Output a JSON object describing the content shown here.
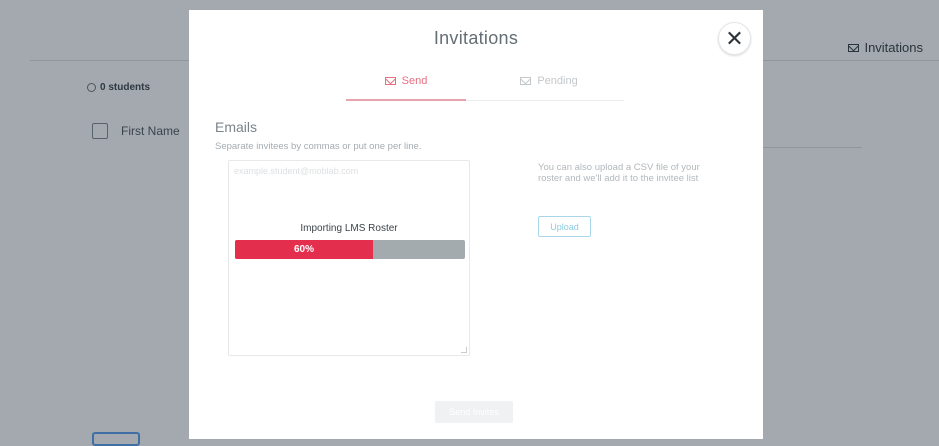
{
  "background": {
    "students_count": "0 students",
    "first_name_header": "First Name",
    "invitations_button": "Invitations"
  },
  "modal": {
    "title": "Invitations",
    "close_icon": "close-icon",
    "tabs": [
      {
        "label": "Send",
        "icon": "envelope-icon",
        "active": true
      },
      {
        "label": "Pending",
        "icon": "envelope-open-icon",
        "active": false
      }
    ],
    "emails_heading": "Emails",
    "emails_subheading": "Separate invitees by commas or put one per line.",
    "email_placeholder": "example.student@moblab.com",
    "import_label": "Importing LMS Roster",
    "import_progress": 0.6,
    "import_progress_text": "60%",
    "csv_text": "You can also upload a CSV file of your roster and we'll add it to the invitee list",
    "upload_label": "Upload",
    "send_label": "Send Invites"
  },
  "colors": {
    "accent": "#e32e4e",
    "tab_active": "#e86f80",
    "upload": "#8ccbe0"
  }
}
